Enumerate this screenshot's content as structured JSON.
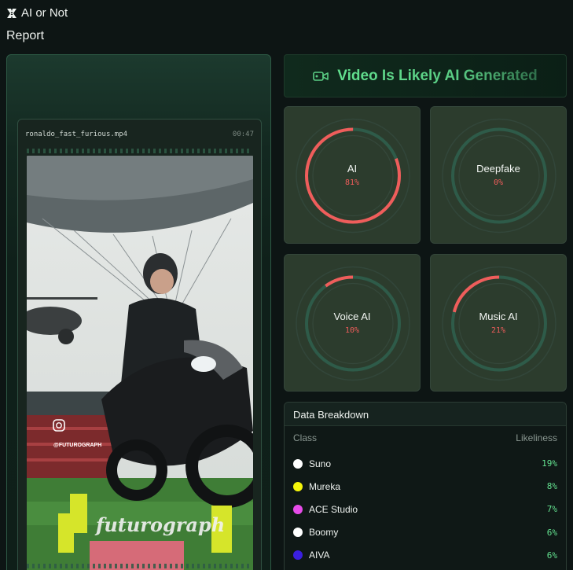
{
  "app": {
    "name": "AI or Not",
    "logo_icon": "ai-or-not-logo-icon"
  },
  "page": {
    "title": "Report"
  },
  "video": {
    "filename": "ronaldo_fast_furious.mp4",
    "duration": "00:47",
    "watermark_handle": "@FUTUROGRAPH",
    "watermark_logo": "futurograph"
  },
  "verdict": {
    "text": "Video Is Likely AI Generated",
    "icon": "video-camera-icon"
  },
  "gauges": [
    {
      "name": "AI",
      "value": "81%",
      "fraction": 0.81
    },
    {
      "name": "Deepfake",
      "value": "0%",
      "fraction": 0
    },
    {
      "name": "Voice AI",
      "value": "10%",
      "fraction": 0.1
    },
    {
      "name": "Music AI",
      "value": "21%",
      "fraction": 0.21
    }
  ],
  "breakdown": {
    "title": "Data Breakdown",
    "col_class": "Class",
    "col_likeliness": "Likeliness",
    "rows": [
      {
        "name": "Suno",
        "value": "19%",
        "color": "#ffffff"
      },
      {
        "name": "Mureka",
        "value": "8%",
        "color": "#f5f50a"
      },
      {
        "name": "ACE Studio",
        "value": "7%",
        "color": "#e64ce8"
      },
      {
        "name": "Boomy",
        "value": "6%",
        "color": "#ffffff"
      },
      {
        "name": "AIVA",
        "value": "6%",
        "color": "#3a1fe0"
      }
    ]
  },
  "colors": {
    "accent_green": "#63e08f",
    "gauge_red": "#ef5d5b",
    "gauge_track": "#2e5b49"
  }
}
